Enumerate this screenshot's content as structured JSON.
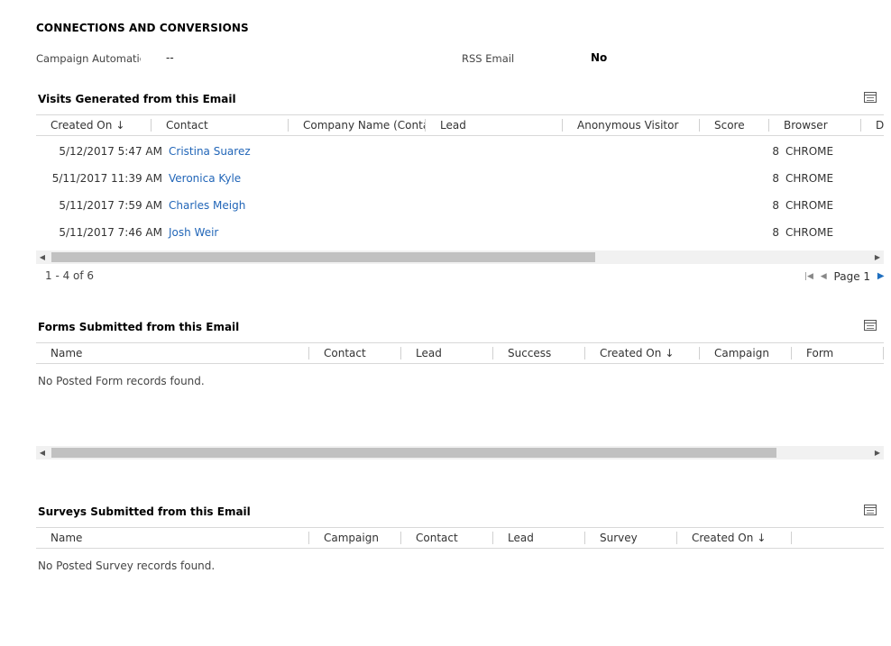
{
  "section": {
    "title": "CONNECTIONS AND CONVERSIONS"
  },
  "fields": {
    "campaign_automation_label": "Campaign Automation",
    "campaign_automation_value": "--",
    "rss_email_label": "RSS Email",
    "rss_email_value": "No"
  },
  "visits": {
    "title": "Visits Generated from this Email",
    "columns": [
      "Created On",
      "Contact",
      "Company Name (Conta...",
      "Lead",
      "Anonymous Visitor",
      "Score",
      "Browser",
      "D"
    ],
    "sort_arrow": "↓",
    "rows": [
      {
        "created_on": "5/12/2017 5:47 AM",
        "contact": "Cristina Suarez",
        "score": "8",
        "browser": "CHROME"
      },
      {
        "created_on": "5/11/2017 11:39 AM",
        "contact": "Veronica Kyle",
        "score": "8",
        "browser": "CHROME"
      },
      {
        "created_on": "5/11/2017 7:59 AM",
        "contact": "Charles Meigh",
        "score": "8",
        "browser": "CHROME"
      },
      {
        "created_on": "5/11/2017 7:46 AM",
        "contact": "Josh Weir",
        "score": "8",
        "browser": "CHROME"
      }
    ],
    "record_count": "1 - 4 of 6",
    "page_label": "Page 1"
  },
  "forms": {
    "title": "Forms Submitted from this Email",
    "columns": [
      "Name",
      "Contact",
      "Lead",
      "Success",
      "Created On",
      "Campaign",
      "Form"
    ],
    "sort_arrow": "↓",
    "empty_text": "No Posted Form records found."
  },
  "surveys": {
    "title": "Surveys Submitted from this Email",
    "columns": [
      "Name",
      "Campaign",
      "Contact",
      "Lead",
      "Survey",
      "Created On"
    ],
    "sort_arrow": "↓",
    "empty_text": "No Posted Survey records found."
  },
  "icons": {
    "grid_view": "grid-view-icon",
    "scroll_left": "◀",
    "scroll_right": "▶",
    "page_first": "|◀",
    "page_prev": "◀",
    "page_next": "▶"
  },
  "colors": {
    "link": "#2266b8",
    "pager_next": "#1f6fbf"
  }
}
